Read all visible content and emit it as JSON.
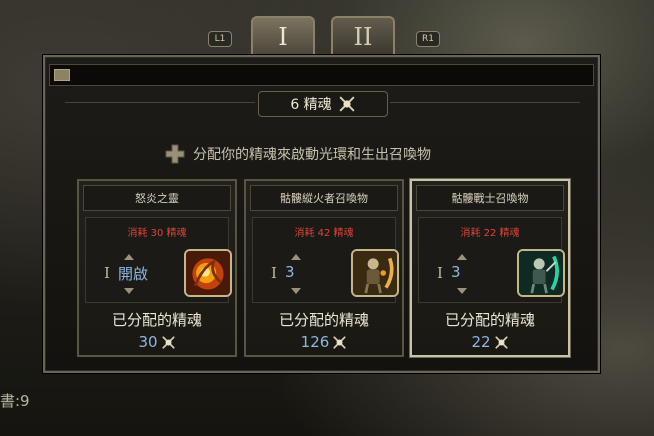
{
  "tabs": [
    {
      "label": "I",
      "active": true
    },
    {
      "label": "II",
      "active": false
    }
  ],
  "shoulder": {
    "left": "L1",
    "right": "R1"
  },
  "background_text": "書:9",
  "header": {
    "essence_count": "6 精魂"
  },
  "instruction": "分配你的精魂來啟動光環和生出召喚物",
  "cards": [
    {
      "title": "怒炎之靈",
      "cost": "消耗 30 精魂",
      "level_numeral": "I",
      "level_value": "開啟",
      "assigned_label": "已分配的精魂",
      "assigned_value": "30",
      "portrait": "fire-spirit-icon",
      "selected": false
    },
    {
      "title": "骷髏縱火者召喚物",
      "cost": "消耗 42 精魂",
      "level_numeral": "I",
      "level_value": "3",
      "assigned_label": "已分配的精魂",
      "assigned_value": "126",
      "portrait": "skeleton-arsonist-icon",
      "selected": false
    },
    {
      "title": "骷髏戰士召喚物",
      "cost": "消耗 22 精魂",
      "level_numeral": "I",
      "level_value": "3",
      "assigned_label": "已分配的精魂",
      "assigned_value": "22",
      "portrait": "skeleton-warrior-icon",
      "selected": true
    }
  ],
  "colors": {
    "cost_red": "#d9453a",
    "value_blue": "#8fb6e0",
    "frame_gold": "#c6b788"
  }
}
